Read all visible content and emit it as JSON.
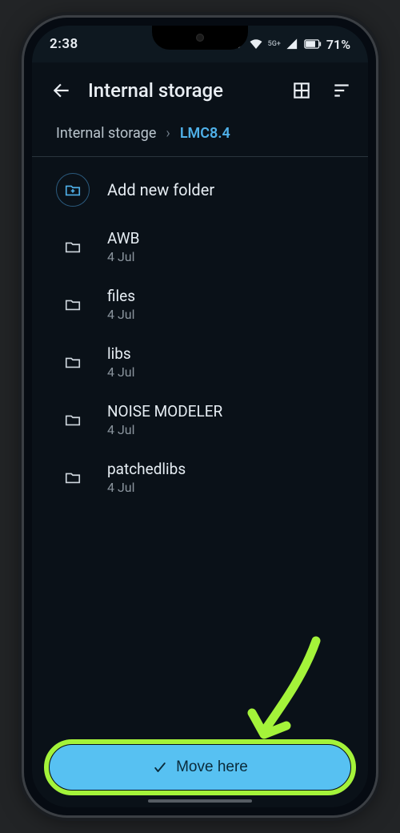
{
  "statusbar": {
    "time": "2:38",
    "battery_pct": "71%",
    "network_badge": "5G+"
  },
  "appbar": {
    "title": "Internal storage"
  },
  "breadcrumbs": {
    "root": "Internal storage",
    "current": "LMC8.4"
  },
  "add_new": {
    "label": "Add new folder"
  },
  "folders": [
    {
      "name": "AWB",
      "date": "4 Jul"
    },
    {
      "name": "files",
      "date": "4 Jul"
    },
    {
      "name": "libs",
      "date": "4 Jul"
    },
    {
      "name": "NOISE MODELER",
      "date": "4 Jul"
    },
    {
      "name": "patchedlibs",
      "date": "4 Jul"
    }
  ],
  "action": {
    "move_label": "Move here"
  }
}
